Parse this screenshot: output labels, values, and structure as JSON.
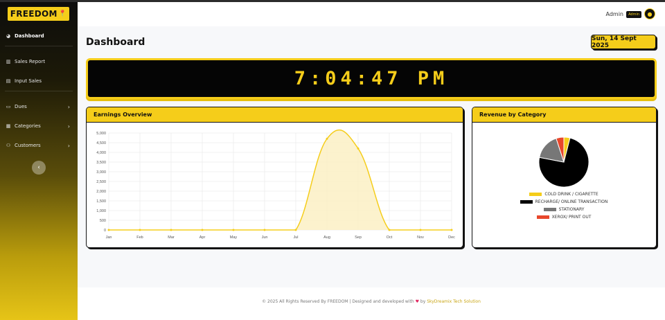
{
  "app": {
    "logo_text": "FREEDOM",
    "logo_icon": "map-pin-icon",
    "brand_color": "#f5cd1a"
  },
  "sidebar": {
    "items": [
      {
        "label": "Dashboard",
        "icon": "gauge-icon"
      },
      {
        "label": "Sales Report",
        "icon": "chart-icon"
      },
      {
        "label": "Input Sales",
        "icon": "file-icon"
      },
      {
        "label": "Dues",
        "icon": "wallet-icon"
      },
      {
        "label": "Categories",
        "icon": "grid-icon"
      },
      {
        "label": "Customers",
        "icon": "users-icon"
      }
    ],
    "collapse_icon": "chevron-left-icon"
  },
  "topbar": {
    "user_label": "Admin",
    "role_badge": "Admin",
    "avatar_icon": "bulb-icon"
  },
  "header": {
    "title": "Dashboard",
    "date": "Sun, 14 Sept 2025"
  },
  "clock": {
    "time": "7:04:47 PM"
  },
  "earnings": {
    "title": "Earnings Overview"
  },
  "revenue": {
    "title": "Revenue by Category"
  },
  "chart_data": [
    {
      "type": "area",
      "title": "Earnings Overview",
      "categories": [
        "Jan",
        "Feb",
        "Mar",
        "Apr",
        "May",
        "Jun",
        "Jul",
        "Aug",
        "Sep",
        "Oct",
        "Nov",
        "Dec"
      ],
      "values": [
        0,
        0,
        0,
        0,
        0,
        0,
        0,
        4700,
        4200,
        0,
        0,
        0
      ],
      "ylim": [
        0,
        5000
      ],
      "yticks": [
        "0",
        "500",
        "1,000",
        "1,500",
        "2,000",
        "2,500",
        "3,000",
        "3,500",
        "4,000",
        "4,500",
        "5,000"
      ],
      "grid": true,
      "line_color": "#f5cd1a",
      "fill_color": "#fbf0c4"
    },
    {
      "type": "pie",
      "title": "Revenue by Category",
      "series": [
        {
          "name": "COLD DRINK / CIGARETTE",
          "value": 4,
          "color": "#f5cd1a"
        },
        {
          "name": "RECHARGE/ ONLINE TRANSACTION",
          "value": 74,
          "color": "#000000"
        },
        {
          "name": "STATIONARY",
          "value": 17,
          "color": "#777777"
        },
        {
          "name": "XEROX/ PRINT OUT",
          "value": 5,
          "color": "#e8472b"
        }
      ],
      "legend": "bottom"
    }
  ],
  "footer": {
    "text_before": "© 2025 All Rights Reserved By FREEDOM | Designed and developed with",
    "heart": "♥",
    "by": "by",
    "brand": "SkyDreamix Tech Solution"
  }
}
